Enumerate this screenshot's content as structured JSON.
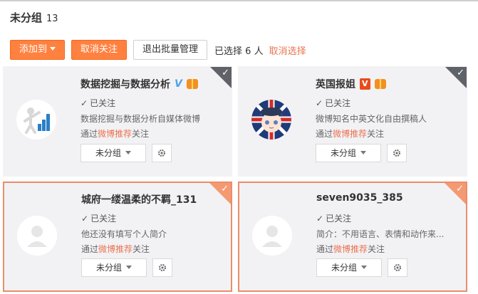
{
  "header": {
    "title": "未分组",
    "count": "13"
  },
  "toolbar": {
    "add_to": "添加到",
    "unfollow": "取消关注",
    "exit_batch": "退出批量管理",
    "selected_text": "已选择 6 人",
    "cancel_select": "取消选择"
  },
  "cards": [
    {
      "name": "数据挖掘与数据分析",
      "verified": "V",
      "followed": "已关注",
      "bio": "数据挖掘与数据分析自媒体微博",
      "via_prefix": "通过",
      "via_link": "微博推荐",
      "via_suffix": "关注",
      "group": "未分组",
      "avatar_icon": "data-analysis-avatar-icon"
    },
    {
      "name": "英国报姐",
      "verified": "V",
      "followed": "已关注",
      "bio": "微博知名中英文化自由撰稿人",
      "via_prefix": "通过",
      "via_link": "微博推荐",
      "via_suffix": "关注",
      "group": "未分组",
      "avatar_icon": "cartoon-girl-union-jack-avatar"
    },
    {
      "name": "城府一缕温柔的不羁_131",
      "followed": "已关注",
      "bio": "他还没有填写个人简介",
      "via_prefix": "通过",
      "via_link": "微博推荐",
      "via_suffix": "关注",
      "group": "未分组",
      "avatar_icon": "default-user-avatar"
    },
    {
      "name": "seven9035_385",
      "followed": "已关注",
      "bio": "简介：不用语言、表情和动作来...",
      "via_prefix": "通过",
      "via_link": "微博推荐",
      "via_suffix": "关注",
      "group": "未分组",
      "avatar_icon": "default-user-avatar"
    }
  ],
  "colors": {
    "accent_orange": "#ff8140",
    "link_orange": "#eb7350",
    "selected_border": "#eb8c6a",
    "card_bg": "#f2f2f5"
  }
}
